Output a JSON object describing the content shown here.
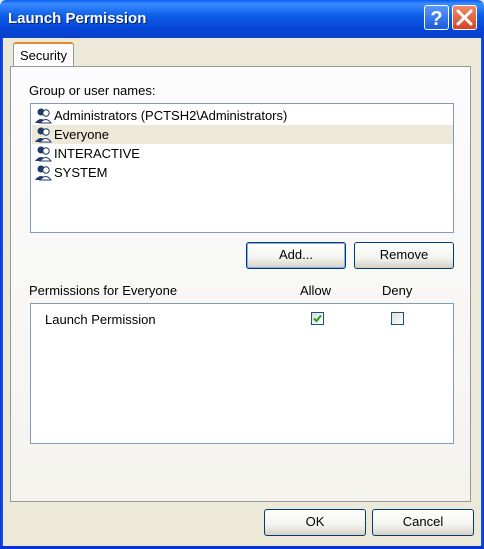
{
  "window": {
    "title": "Launch Permission"
  },
  "titlebar_buttons": {
    "help_icon": "help-icon",
    "close_icon": "close-icon"
  },
  "tabs": [
    {
      "label": "Security",
      "active": true
    }
  ],
  "group_section": {
    "label": "Group or user names:",
    "users": [
      {
        "label": "Administrators (PCTSH2\\Administrators)",
        "icon": "user-group-icon",
        "selected": false
      },
      {
        "label": "Everyone",
        "icon": "user-group-icon",
        "selected": true
      },
      {
        "label": "INTERACTIVE",
        "icon": "user-group-icon",
        "selected": false
      },
      {
        "label": "SYSTEM",
        "icon": "user-group-icon",
        "selected": false
      }
    ],
    "add_label": "Add...",
    "remove_label": "Remove"
  },
  "permissions_section": {
    "label": "Permissions for Everyone",
    "allow_header": "Allow",
    "deny_header": "Deny",
    "rows": [
      {
        "label": "Launch Permission",
        "allow": true,
        "deny": false
      }
    ]
  },
  "footer": {
    "ok_label": "OK",
    "cancel_label": "Cancel"
  },
  "colors": {
    "titlebar": "#0a5df0",
    "dialog_bg": "#ece9d8",
    "close_red": "#d54421",
    "check_green": "#21a121"
  }
}
